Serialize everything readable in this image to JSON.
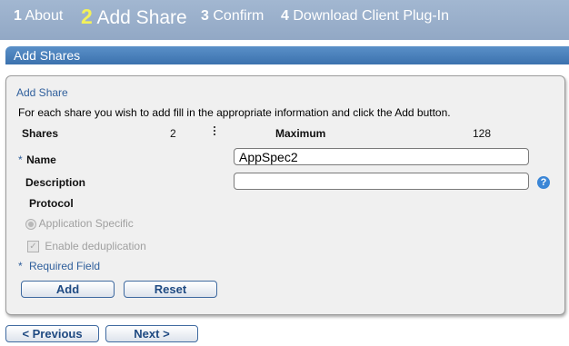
{
  "wizard": {
    "steps": [
      {
        "num": "1",
        "label": "About"
      },
      {
        "num": "2",
        "label": "Add Share"
      },
      {
        "num": "3",
        "label": "Confirm"
      },
      {
        "num": "4",
        "label": "Download Client Plug-In"
      }
    ],
    "active_step": "2"
  },
  "section": {
    "title": "Add Shares"
  },
  "panel": {
    "title": "Add Share",
    "instructions": "For each share you wish to add fill in the appropriate information and click the Add button.",
    "shares_label": "Shares",
    "shares_value": "2",
    "maximum_label": "Maximum",
    "maximum_value": "128",
    "name_star": "*",
    "name_label": "Name",
    "name_value": "AppSpec2",
    "description_label": "Description",
    "description_value": "",
    "help_icon": "?",
    "protocol_label": "Protocol",
    "protocol_option": "Application Specific",
    "dedup_label": "Enable deduplication",
    "required_star": "*",
    "required_text": "Required Field",
    "add_button": "Add",
    "reset_button": "Reset"
  },
  "nav": {
    "previous_button": "< Previous",
    "next_button": "Next >"
  },
  "colors": {
    "wizard_bg": "#9aafcb",
    "active_step_number": "#f3f15a",
    "header_blue": "#3c72ae",
    "link_blue": "#2f5f9c"
  }
}
